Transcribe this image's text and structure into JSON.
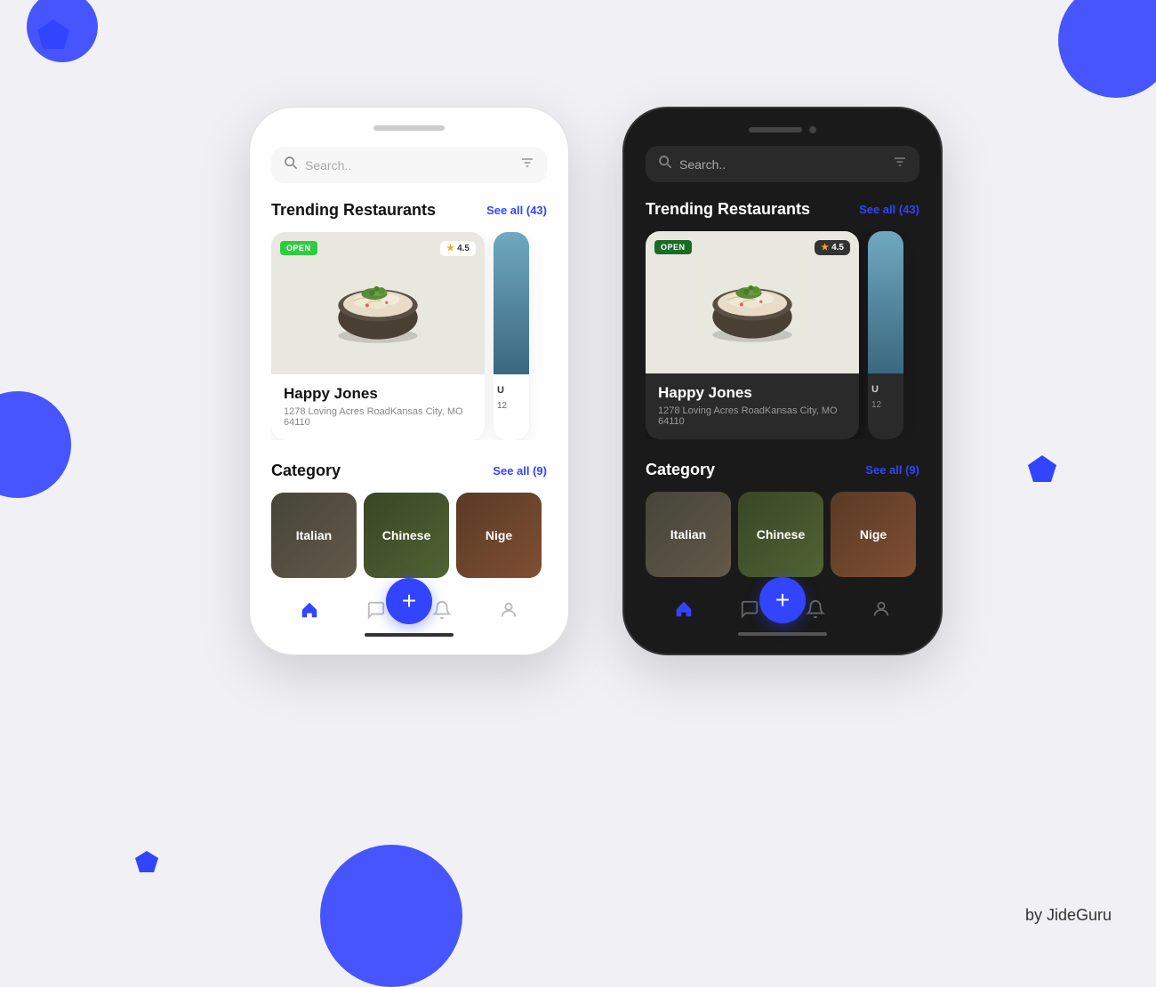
{
  "page": {
    "bg_color": "#f0f0f5",
    "accent_color": "#3344ff"
  },
  "watermark": "by JideGuru",
  "light_phone": {
    "search_placeholder": "Search..",
    "trending_title": "Trending Restaurants",
    "trending_see_all": "See all (43)",
    "category_title": "Category",
    "category_see_all": "See all (9)",
    "restaurant": {
      "badge_open": "OPEN",
      "rating": "4.5",
      "name": "Happy Jones",
      "address": "1278 Loving Acres RoadKansas City, MO 64110"
    },
    "categories": [
      {
        "label": "Italian"
      },
      {
        "label": "Chinese"
      },
      {
        "label": "Nige"
      }
    ],
    "nav_items": [
      "home",
      "chat",
      "add",
      "bell",
      "person"
    ]
  },
  "dark_phone": {
    "search_placeholder": "Search..",
    "trending_title": "Trending Restaurants",
    "trending_see_all": "See all (43)",
    "category_title": "Category",
    "category_see_all": "See all (9)",
    "restaurant": {
      "badge_open": "OPEN",
      "rating": "4.5",
      "name": "Happy Jones",
      "address": "1278 Loving Acres RoadKansas City, MO 64110"
    },
    "categories": [
      {
        "label": "Italian"
      },
      {
        "label": "Chinese"
      },
      {
        "label": "Nige"
      }
    ],
    "nav_items": [
      "home",
      "chat",
      "add",
      "bell",
      "person"
    ]
  }
}
